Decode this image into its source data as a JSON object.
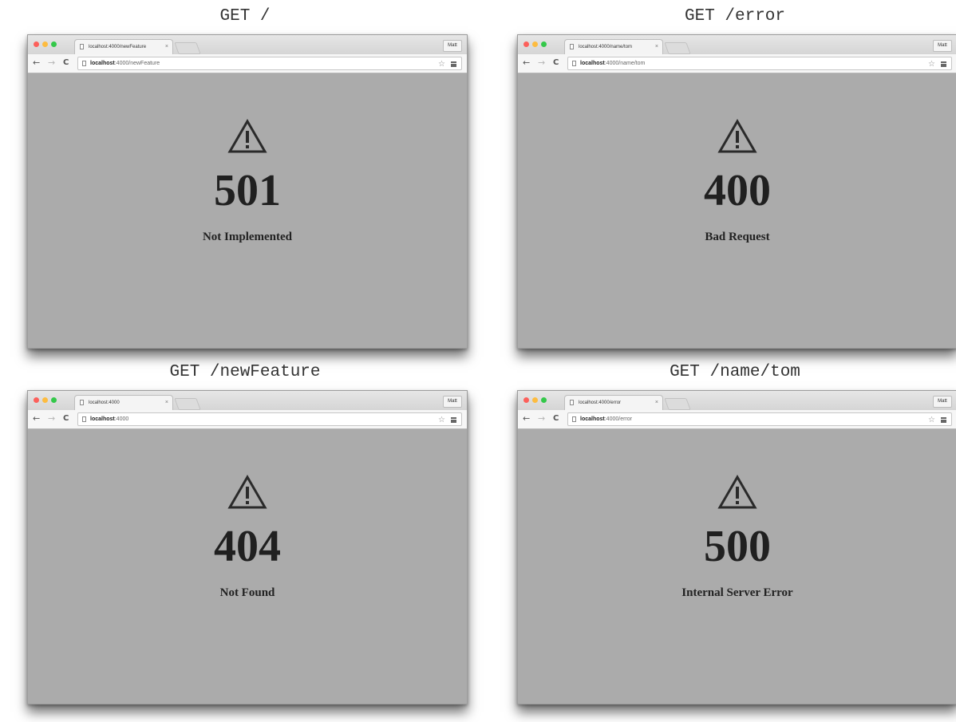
{
  "panels": [
    {
      "caption": "GET /",
      "tab_title": "localhost:4000/newFeature",
      "url_host": "localhost",
      "url_rest": ":4000/newFeature",
      "status_code": "501",
      "status_text": "Not Implemented"
    },
    {
      "caption": "GET /error",
      "tab_title": "localhost:4000/name/tom",
      "url_host": "localhost",
      "url_rest": ":4000/name/tom",
      "status_code": "400",
      "status_text": "Bad Request"
    },
    {
      "caption": "GET /newFeature",
      "tab_title": "localhost:4000",
      "url_host": "localhost",
      "url_rest": ":4000",
      "status_code": "404",
      "status_text": "Not Found"
    },
    {
      "caption": "GET /name/tom",
      "tab_title": "localhost:4000/error",
      "url_host": "localhost",
      "url_rest": ":4000/error",
      "status_code": "500",
      "status_text": "Internal Server Error"
    }
  ],
  "browser": {
    "user_label": "Matt",
    "tab_close": "×",
    "back_icon": "←",
    "forward_icon": "→",
    "reload_icon": "C",
    "star_icon": "☆"
  },
  "colors": {
    "page_background": "#ababab",
    "close_light": "#fc605b",
    "minimize_light": "#fdbc40",
    "zoom_light": "#34c84a"
  }
}
